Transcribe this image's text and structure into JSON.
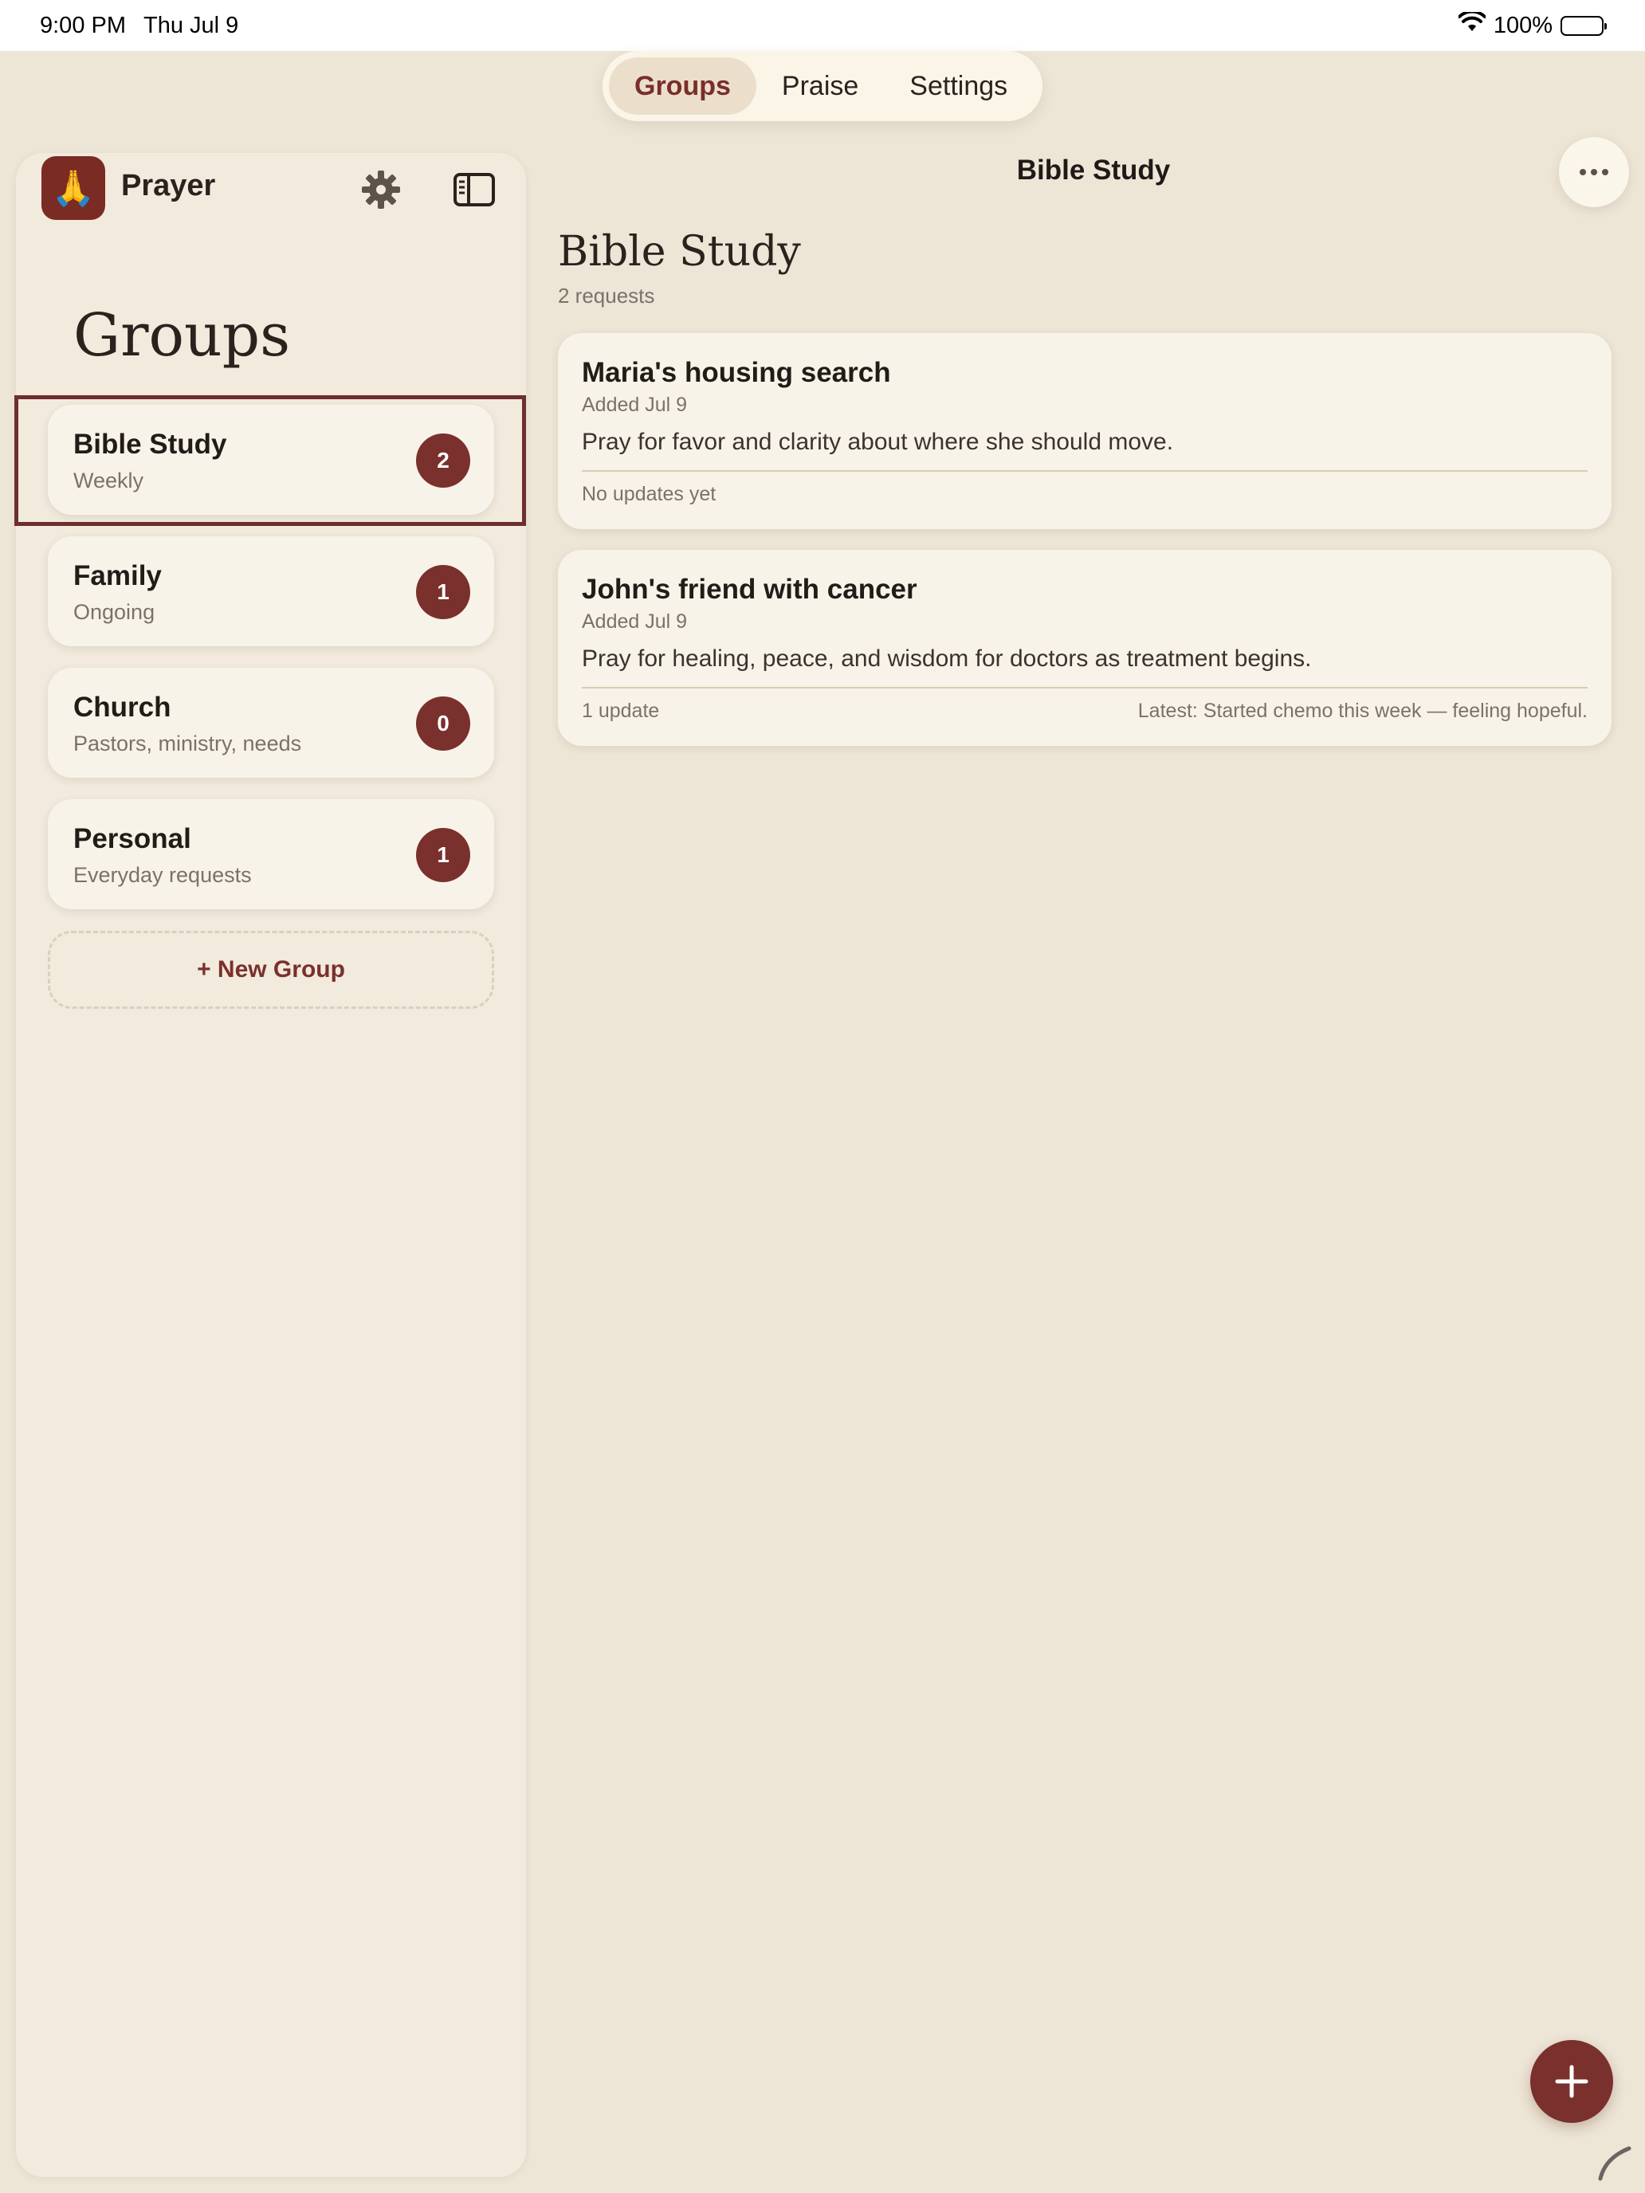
{
  "status_bar": {
    "time": "9:00 PM",
    "date": "Thu Jul 9",
    "battery_text": "100%",
    "icons": [
      "wifi-icon",
      "battery-icon"
    ]
  },
  "top_nav": {
    "tabs": [
      {
        "label": "Groups",
        "active": true
      },
      {
        "label": "Praise",
        "active": false
      },
      {
        "label": "Settings",
        "active": false
      }
    ]
  },
  "sidebar": {
    "app_title": "Prayer",
    "app_icon_glyph": "🙏",
    "heading": "Groups",
    "groups": [
      {
        "name": "Bible Study",
        "subtitle": "Weekly",
        "count": "2",
        "selected": true
      },
      {
        "name": "Family",
        "subtitle": "Ongoing",
        "count": "1",
        "selected": false
      },
      {
        "name": "Church",
        "subtitle": "Pastors, ministry, needs",
        "count": "0",
        "selected": false
      },
      {
        "name": "Personal",
        "subtitle": "Everyday requests",
        "count": "1",
        "selected": false
      }
    ],
    "new_group_label": "+ New Group"
  },
  "main": {
    "nav_title": "Bible Study",
    "title": "Bible Study",
    "subtitle": "2 requests",
    "requests": [
      {
        "title": "Maria's housing search",
        "added": "Added Jul 9",
        "body": "Pray for favor and clarity about where she should move.",
        "updates": "No updates yet",
        "latest": ""
      },
      {
        "title": "John's friend with cancer",
        "added": "Added Jul 9",
        "body": "Pray for healing, peace, and wisdom for doctors as treatment begins.",
        "updates": "1 update",
        "latest": "Latest: Started chemo this week — feeling hopeful."
      }
    ]
  },
  "colors": {
    "accent": "#7a302c",
    "background": "#ede5d6",
    "card": "#f8f3e8",
    "selection_outline": "#6e2d2f"
  }
}
